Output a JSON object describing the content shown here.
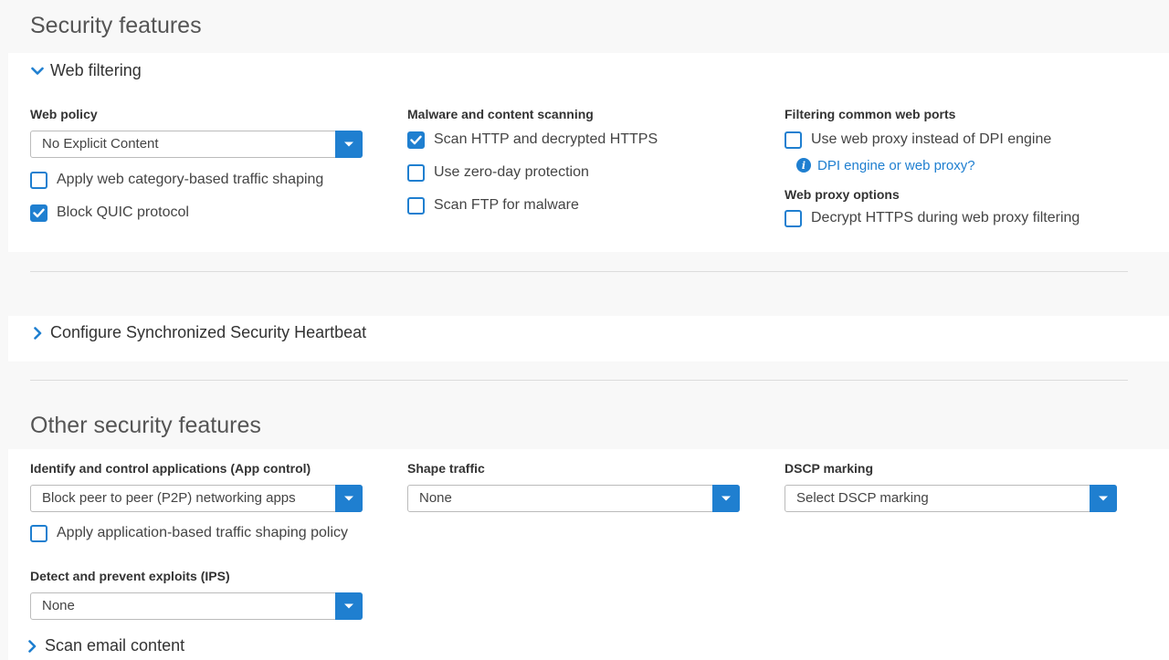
{
  "security_features": {
    "title": "Security features",
    "web_filtering": {
      "label": "Web filtering",
      "web_policy": {
        "label": "Web policy",
        "selected": "No Explicit Content",
        "apply_shaping": {
          "label": "Apply web category-based traffic shaping",
          "checked": false
        },
        "block_quic": {
          "label": "Block QUIC protocol",
          "checked": true
        }
      },
      "malware": {
        "label": "Malware and content scanning",
        "scan_http": {
          "label": "Scan HTTP and decrypted HTTPS",
          "checked": true
        },
        "zero_day": {
          "label": "Use zero-day protection",
          "checked": false
        },
        "scan_ftp": {
          "label": "Scan FTP for malware",
          "checked": false
        }
      },
      "ports": {
        "label": "Filtering common web ports",
        "use_proxy": {
          "label": "Use web proxy instead of DPI engine",
          "checked": false
        },
        "help_link": "DPI engine or web proxy?"
      },
      "proxy_options": {
        "label": "Web proxy options",
        "decrypt_https": {
          "label": "Decrypt HTTPS during web proxy filtering",
          "checked": false
        }
      }
    },
    "heartbeat": {
      "label": "Configure Synchronized Security Heartbeat"
    }
  },
  "other_security": {
    "title": "Other security features",
    "app_control": {
      "label": "Identify and control applications (App control)",
      "selected": "Block peer to peer (P2P) networking apps",
      "apply_shaping": {
        "label": "Apply application-based traffic shaping policy",
        "checked": false
      }
    },
    "shape_traffic": {
      "label": "Shape traffic",
      "selected": "None"
    },
    "dscp": {
      "label": "DSCP marking",
      "selected": "Select DSCP marking"
    },
    "ips": {
      "label": "Detect and prevent exploits (IPS)",
      "selected": "None"
    },
    "scan_email": {
      "label": "Scan email content"
    }
  },
  "colors": {
    "accent": "#1f7fd0",
    "panel": "#ffffff",
    "background": "#f8f8f8"
  }
}
